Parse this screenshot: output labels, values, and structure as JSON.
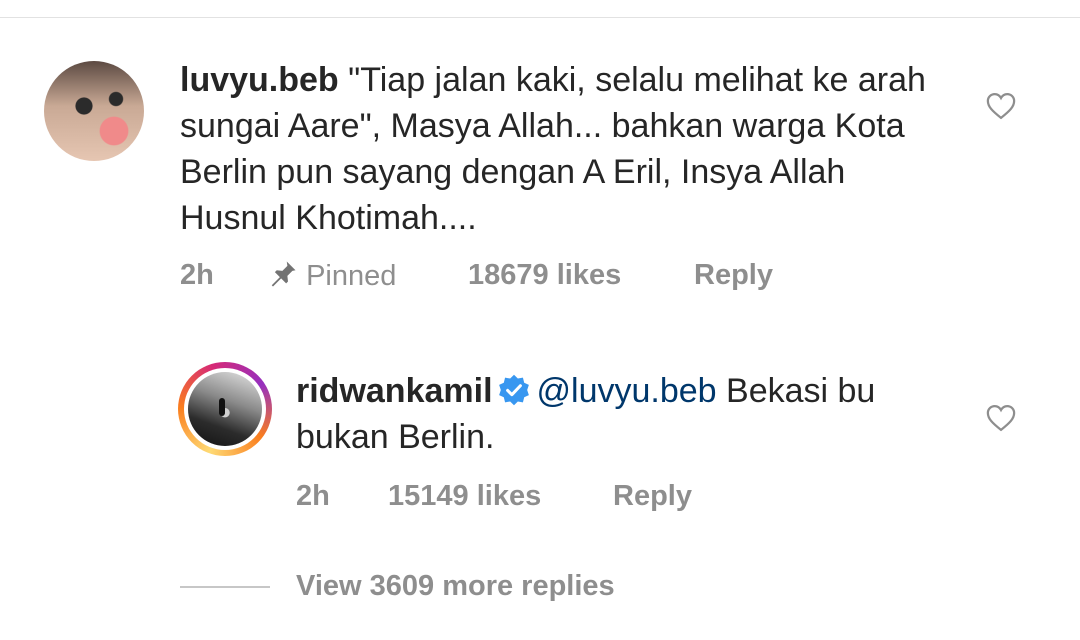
{
  "comment": {
    "username": "luvyu.beb",
    "text": "\"Tiap jalan kaki, selalu melihat ke arah sungai Aare\", Masya Allah... bahkan warga Kota Berlin pun sayang dengan A Eril, Insya Allah Husnul Khotimah....",
    "time": "2h",
    "pinned_label": "Pinned",
    "likes": "18679 likes",
    "reply_label": "Reply"
  },
  "reply": {
    "username": "ridwankamil",
    "verified": true,
    "mention": "@luvyu.beb",
    "text": "Bekasi bu bukan Berlin.",
    "time": "2h",
    "likes": "15149 likes",
    "reply_label": "Reply"
  },
  "view_more_replies": "View 3609 more replies",
  "colors": {
    "text": "#262626",
    "secondary": "#8e8e8e",
    "mention": "#00376b",
    "verified": "#3897f0"
  },
  "icons": [
    "pin-icon",
    "heart-icon",
    "verified-badge-icon"
  ]
}
